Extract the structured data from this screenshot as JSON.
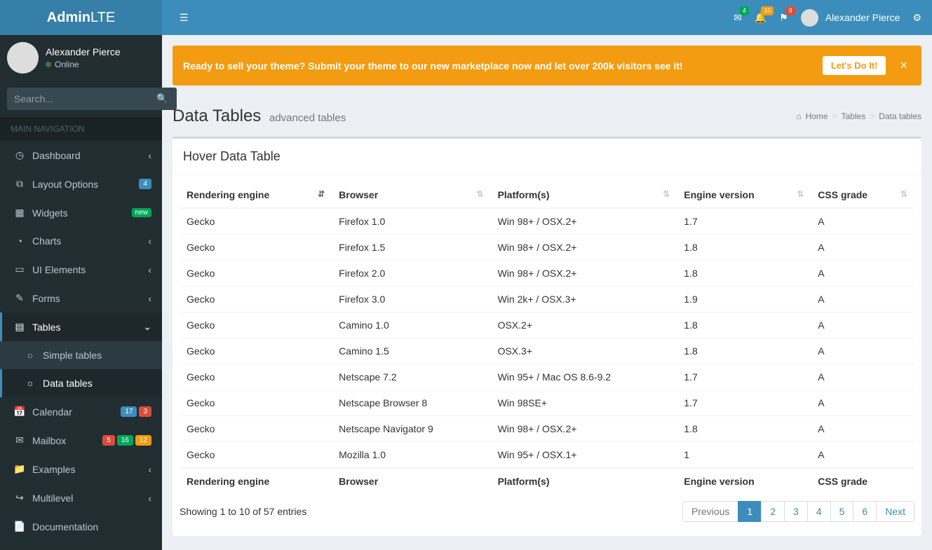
{
  "logo": {
    "bold": "Admin",
    "light": "LTE"
  },
  "navbar": {
    "mail_badge": "4",
    "bell_badge": "10",
    "flag_badge": "9",
    "user_name": "Alexander Pierce"
  },
  "sidebar": {
    "user_name": "Alexander Pierce",
    "user_status": "Online",
    "search_placeholder": "Search...",
    "header": "MAIN NAVIGATION",
    "items": [
      {
        "icon": "◷",
        "label": "Dashboard",
        "chevron": true
      },
      {
        "icon": "⧉",
        "label": "Layout Options",
        "badge": "4",
        "badge_cls": "bg-blue"
      },
      {
        "icon": "▦",
        "label": "Widgets",
        "tag": "new"
      },
      {
        "icon": "◔",
        "label": "Charts",
        "chevron": true
      },
      {
        "icon": "▭",
        "label": "UI Elements",
        "chevron": true
      },
      {
        "icon": "✎",
        "label": "Forms",
        "chevron": true
      },
      {
        "icon": "▤",
        "label": "Tables",
        "chevron": true,
        "active": true,
        "open": true
      },
      {
        "icon": "📅",
        "label": "Calendar",
        "badges": [
          {
            "t": "17",
            "c": "bg-blue"
          },
          {
            "t": "3",
            "c": "bg-red"
          }
        ]
      },
      {
        "icon": "✉",
        "label": "Mailbox",
        "badges": [
          {
            "t": "5",
            "c": "bg-red"
          },
          {
            "t": "16",
            "c": "bg-green"
          },
          {
            "t": "12",
            "c": "bg-yellow"
          }
        ]
      },
      {
        "icon": "📁",
        "label": "Examples",
        "chevron": true
      },
      {
        "icon": "↪",
        "label": "Multilevel",
        "chevron": true
      },
      {
        "icon": "📄",
        "label": "Documentation"
      }
    ],
    "sub_tables": [
      {
        "label": "Simple tables",
        "active": false
      },
      {
        "label": "Data tables",
        "active": true
      }
    ]
  },
  "callout": {
    "text": "Ready to sell your theme? Submit your theme to our new marketplace now and let over 200k visitors see it!",
    "button": "Let's Do It!"
  },
  "page": {
    "title": "Data Tables",
    "subtitle": "advanced tables",
    "breadcrumb": [
      "Home",
      "Tables",
      "Data tables"
    ]
  },
  "box": {
    "title": "Hover Data Table",
    "columns": [
      "Rendering engine",
      "Browser",
      "Platform(s)",
      "Engine version",
      "CSS grade"
    ],
    "rows": [
      [
        "Gecko",
        "Firefox 1.0",
        "Win 98+ / OSX.2+",
        "1.7",
        "A"
      ],
      [
        "Gecko",
        "Firefox 1.5",
        "Win 98+ / OSX.2+",
        "1.8",
        "A"
      ],
      [
        "Gecko",
        "Firefox 2.0",
        "Win 98+ / OSX.2+",
        "1.8",
        "A"
      ],
      [
        "Gecko",
        "Firefox 3.0",
        "Win 2k+ / OSX.3+",
        "1.9",
        "A"
      ],
      [
        "Gecko",
        "Camino 1.0",
        "OSX.2+",
        "1.8",
        "A"
      ],
      [
        "Gecko",
        "Camino 1.5",
        "OSX.3+",
        "1.8",
        "A"
      ],
      [
        "Gecko",
        "Netscape 7.2",
        "Win 95+ / Mac OS 8.6-9.2",
        "1.7",
        "A"
      ],
      [
        "Gecko",
        "Netscape Browser 8",
        "Win 98SE+",
        "1.7",
        "A"
      ],
      [
        "Gecko",
        "Netscape Navigator 9",
        "Win 98+ / OSX.2+",
        "1.8",
        "A"
      ],
      [
        "Gecko",
        "Mozilla 1.0",
        "Win 95+ / OSX.1+",
        "1",
        "A"
      ]
    ],
    "info": "Showing 1 to 10 of 57 entries",
    "pagination": {
      "prev": "Previous",
      "next": "Next",
      "pages": [
        "1",
        "2",
        "3",
        "4",
        "5",
        "6"
      ],
      "active": "1"
    }
  }
}
